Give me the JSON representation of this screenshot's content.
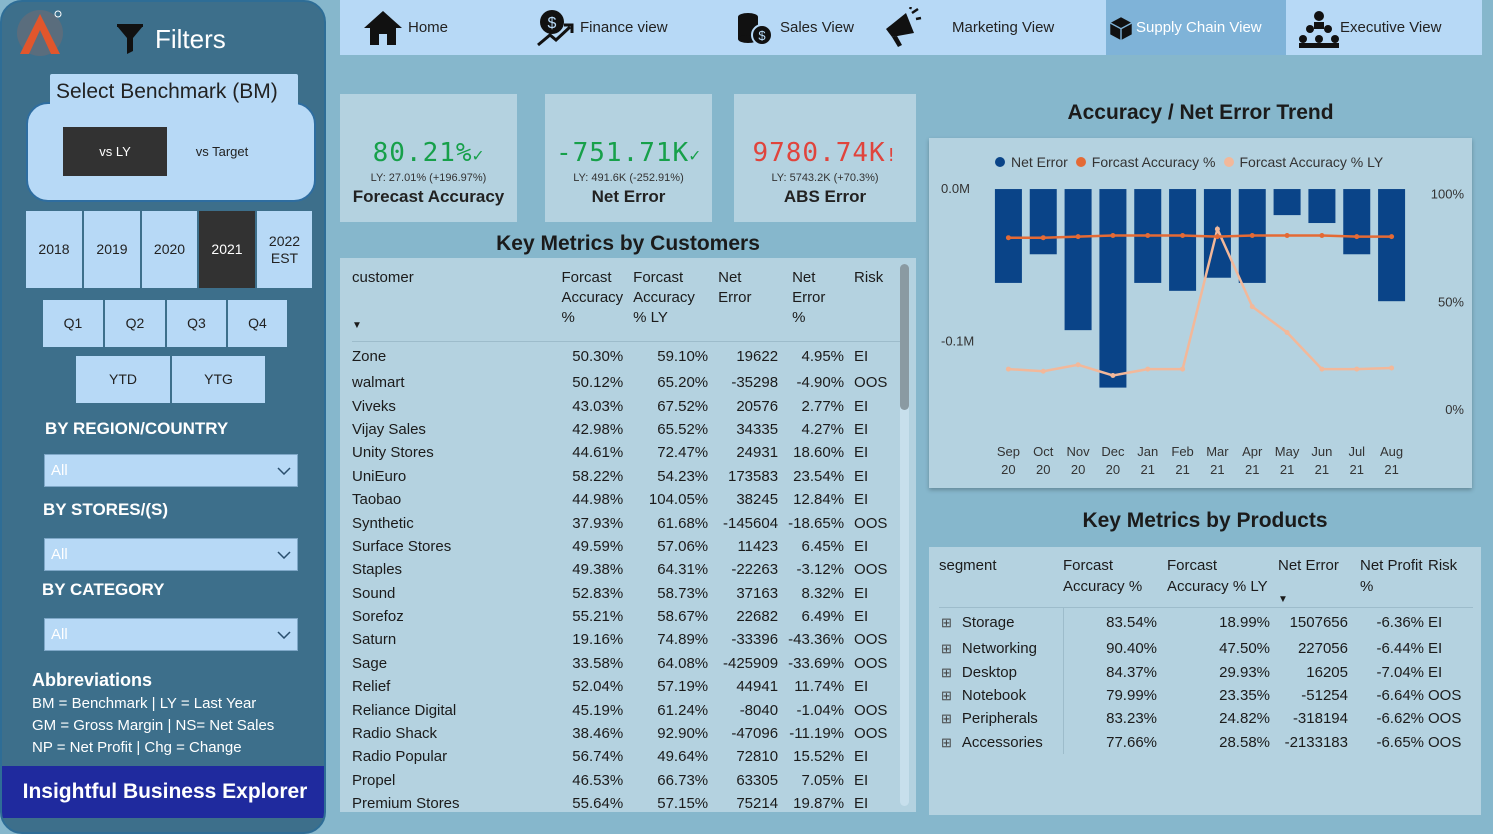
{
  "sidebar": {
    "filters_title": "Filters",
    "benchmark_title": "Select Benchmark (BM)",
    "benchmark_options": [
      "vs LY",
      "vs Target"
    ],
    "years": [
      "2018",
      "2019",
      "2020",
      "2021",
      "2022 EST"
    ],
    "quarters": [
      "Q1",
      "Q2",
      "Q3",
      "Q4"
    ],
    "periods": [
      "YTD",
      "YTG"
    ],
    "region_label": "BY REGION/COUNTRY",
    "region_value": "All",
    "stores_label": "BY STORES/(S)",
    "stores_value": "All",
    "category_label": "BY CATEGORY",
    "category_value": "All",
    "abbr_title": "Abbreviations",
    "abbr_lines": [
      "BM = Benchmark | LY = Last Year",
      "GM = Gross Margin | NS= Net Sales",
      "NP = Net Profit | Chg = Change"
    ],
    "brand": "Insightful Business Explorer"
  },
  "nav": [
    "Home",
    "Finance view",
    "Sales View",
    "Marketing View",
    "Supply Chain View",
    "Executive View"
  ],
  "kpis": [
    {
      "value": "80.21%",
      "mark": "✓",
      "sub": "LY: 27.01% (+196.97%)",
      "label": "Forecast Accuracy",
      "color": "#17a04a"
    },
    {
      "value": "-751.71K",
      "mark": "✓",
      "sub": "LY: 491.6K (-252.91%)",
      "label": "Net Error",
      "color": "#17a04a"
    },
    {
      "value": "9780.74K",
      "mark": "!",
      "sub": "LY: 5743.2K (+70.3%)",
      "label": "ABS Error",
      "color": "#e0443c"
    }
  ],
  "customers": {
    "title": "Key Metrics by Customers",
    "headers": [
      "customer",
      "Forcast Accuracy %",
      "Forcast Accuracy % LY",
      "Net Error",
      "Net Error %",
      "Risk"
    ],
    "rows": [
      [
        "Zone",
        "50.30%",
        "59.10%",
        "19622",
        "4.95%",
        "EI"
      ],
      [
        "walmart",
        "50.12%",
        "65.20%",
        "-35298",
        "-4.90%",
        "OOS"
      ],
      [
        "Viveks",
        "43.03%",
        "67.52%",
        "20576",
        "2.77%",
        "EI"
      ],
      [
        "Vijay Sales",
        "42.98%",
        "65.52%",
        "34335",
        "4.27%",
        "EI"
      ],
      [
        "Unity Stores",
        "44.61%",
        "72.47%",
        "24931",
        "18.60%",
        "EI"
      ],
      [
        "UniEuro",
        "58.22%",
        "54.23%",
        "173583",
        "23.54%",
        "EI"
      ],
      [
        "Taobao",
        "44.98%",
        "104.05%",
        "38245",
        "12.84%",
        "EI"
      ],
      [
        "Synthetic",
        "37.93%",
        "61.68%",
        "-145604",
        "-18.65%",
        "OOS"
      ],
      [
        "Surface Stores",
        "49.59%",
        "57.06%",
        "11423",
        "6.45%",
        "EI"
      ],
      [
        "Staples",
        "49.38%",
        "64.31%",
        "-22263",
        "-3.12%",
        "OOS"
      ],
      [
        "Sound",
        "52.83%",
        "58.73%",
        "37163",
        "8.32%",
        "EI"
      ],
      [
        "Sorefoz",
        "55.21%",
        "58.67%",
        "22682",
        "6.49%",
        "EI"
      ],
      [
        "Saturn",
        "19.16%",
        "74.89%",
        "-33396",
        "-43.36%",
        "OOS"
      ],
      [
        "Sage",
        "33.58%",
        "64.08%",
        "-425909",
        "-33.69%",
        "OOS"
      ],
      [
        "Relief",
        "52.04%",
        "57.19%",
        "44941",
        "11.74%",
        "EI"
      ],
      [
        "Reliance Digital",
        "45.19%",
        "61.24%",
        "-8040",
        "-1.04%",
        "OOS"
      ],
      [
        "Radio Shack",
        "38.46%",
        "92.90%",
        "-47096",
        "-11.19%",
        "OOS"
      ],
      [
        "Radio Popular",
        "56.74%",
        "49.64%",
        "72810",
        "15.52%",
        "EI"
      ],
      [
        "Propel",
        "46.53%",
        "66.73%",
        "63305",
        "7.05%",
        "EI"
      ],
      [
        "Premium Stores",
        "55.64%",
        "57.15%",
        "75214",
        "19.87%",
        "EI"
      ]
    ]
  },
  "products": {
    "title": "Key Metrics by Products",
    "headers": [
      "segment",
      "Forcast Accuracy %",
      "Forcast Accuracy % LY",
      "Net Error",
      "Net Profit %",
      "Risk"
    ],
    "rows": [
      [
        "Storage",
        "83.54%",
        "18.99%",
        "1507656",
        "-6.36%",
        "EI"
      ],
      [
        "Networking",
        "90.40%",
        "47.50%",
        "227056",
        "-6.44%",
        "EI"
      ],
      [
        "Desktop",
        "84.37%",
        "29.93%",
        "16205",
        "-7.04%",
        "EI"
      ],
      [
        "Notebook",
        "79.99%",
        "23.35%",
        "-51254",
        "-6.64%",
        "OOS"
      ],
      [
        "Peripherals",
        "83.23%",
        "24.82%",
        "-318194",
        "-6.62%",
        "OOS"
      ],
      [
        "Accessories",
        "77.66%",
        "28.58%",
        "-2133183",
        "-6.65%",
        "OOS"
      ]
    ]
  },
  "chart_data": {
    "type": "bar",
    "title": "Accuracy / Net Error Trend",
    "categories": [
      "Sep 20",
      "Oct 20",
      "Nov 20",
      "Dec 20",
      "Jan 21",
      "Feb 21",
      "Mar 21",
      "Apr 21",
      "May 21",
      "Jun 21",
      "Jul 21",
      "Aug 21"
    ],
    "series": [
      {
        "name": "Net Error",
        "type": "bar",
        "axis": "left",
        "color": "#0a4488",
        "values": [
          -0.0616,
          -0.0428,
          -0.0926,
          -0.1303,
          -0.0616,
          -0.0668,
          -0.0582,
          -0.0616,
          -0.0171,
          -0.0223,
          -0.0428,
          -0.0736
        ]
      },
      {
        "name": "Forcast Accuracy %",
        "type": "line",
        "axis": "right",
        "color": "#e46a35",
        "values": [
          80,
          80,
          80.5,
          81,
          81,
          81,
          80.5,
          81,
          81,
          81,
          80.5,
          80.5
        ]
      },
      {
        "name": "Forcast Accuracy % LY",
        "type": "line",
        "axis": "right",
        "color": "#f2b89a",
        "values": [
          19,
          18,
          21,
          16,
          19,
          19,
          84,
          48,
          36,
          19,
          19,
          19.5
        ]
      }
    ],
    "y_left_ticks": [
      "0.0M",
      "-0.1M"
    ],
    "y_right_ticks": [
      "100%",
      "50%",
      "0%"
    ],
    "y_left_range": [
      -0.145,
      0.002
    ],
    "y_right_range": [
      0,
      104
    ],
    "legend_position": "top"
  }
}
